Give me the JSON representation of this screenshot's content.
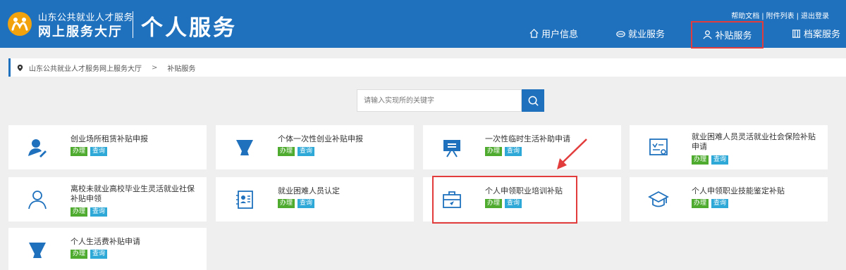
{
  "header": {
    "brand_sub": "山东公共就业人才服务",
    "brand_main": "网上服务大厅",
    "title": "个人服务",
    "links": [
      "帮助文档",
      "附件列表",
      "退出登录"
    ],
    "nav": [
      {
        "label": "用户信息",
        "icon": "home-icon"
      },
      {
        "label": "就业服务",
        "icon": "cloud-icon"
      },
      {
        "label": "补贴服务",
        "icon": "people-icon"
      },
      {
        "label": "档案服务",
        "icon": "archive-icon"
      }
    ]
  },
  "breadcrumb": {
    "home": "山东公共就业人才服务网上服务大厅",
    "arrow": ">",
    "current": "补贴服务"
  },
  "search": {
    "placeholder": "请输入实现所的关键字"
  },
  "buttons": {
    "do": "办理",
    "query": "查询"
  },
  "cards": [
    {
      "title": "创业场所租赁补贴申报",
      "icon": "user-edit-icon"
    },
    {
      "title": "个体一次性创业补贴申报",
      "icon": "cone-icon"
    },
    {
      "title": "一次性临时生活补助申请",
      "icon": "board-icon"
    },
    {
      "title": "就业困难人员灵活就业社会保险补贴申请",
      "icon": "certificate-icon"
    },
    {
      "title": "离校未就业高校毕业生灵活就业社保补贴申领",
      "icon": "person-icon"
    },
    {
      "title": "就业困难人员认定",
      "icon": "id-card-icon"
    },
    {
      "title": "个人申领职业培训补贴",
      "icon": "briefcase-icon"
    },
    {
      "title": "个人申领职业技能鉴定补贴",
      "icon": "graduation-cap-icon"
    },
    {
      "title": "个人生活费补贴申请",
      "icon": "cone-icon"
    }
  ],
  "colors": {
    "primary": "#1f71bd",
    "do": "#4eab2f",
    "query": "#2da8d7",
    "highlight": "#e23c3c"
  }
}
